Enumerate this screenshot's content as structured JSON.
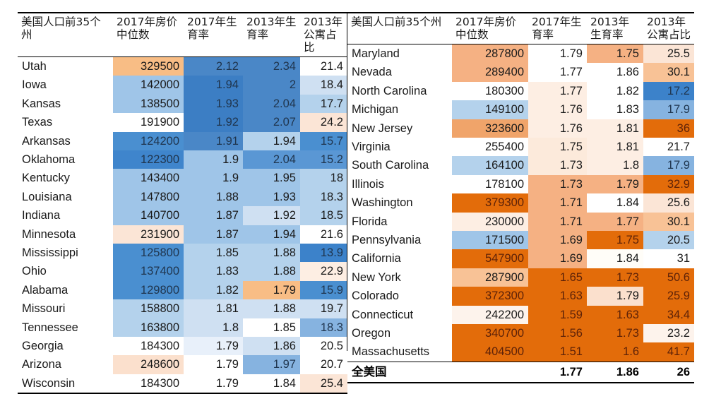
{
  "headers_left": [
    "美国人口前35个州",
    "2017年房价中位数",
    "2017年生育率",
    "2013年生育率",
    "2013年公寓占比"
  ],
  "headers_right": [
    "美国人口前35个州",
    "2017年房价中位数",
    "2017年生育率",
    "2013年生育率",
    "2013年公寓占比"
  ],
  "total_label": "全美国",
  "chart_data": {
    "type": "table",
    "title": "美国人口前35个州 房价中位数与生育率对照表",
    "columns": [
      "州",
      "2017年房价中位数",
      "2017年生育率",
      "2013年生育率",
      "2013年公寓占比"
    ],
    "colormap": {
      "low_blue": "#2e75b6",
      "mid_blue": "#9cc3e5",
      "neutral": "#ffffff",
      "mid_orange": "#f8cbad",
      "high_orange": "#e36c0a"
    },
    "left_rows": [
      {
        "state": "Utah",
        "price": "329500",
        "price_c": "#f8bd85",
        "fert2017": "2.12",
        "f17_c": "#4a87c7",
        "fert2013": "2.34",
        "f13_c": "#4a87c7",
        "apt": "21.4",
        "apt_c": "#ffffff"
      },
      {
        "state": "Iowa",
        "price": "142000",
        "price_c": "#9fc5e8",
        "fert2017": "1.94",
        "f17_c": "#3c7ec4",
        "fert2013": "2",
        "f13_c": "#4a87c7",
        "apt": "18.4",
        "apt_c": "#cfe0f2"
      },
      {
        "state": "Kansas",
        "price": "138500",
        "price_c": "#9fc5e8",
        "fert2017": "1.93",
        "f17_c": "#3c7ec4",
        "fert2013": "2.04",
        "f13_c": "#4a87c7",
        "apt": "17.7",
        "apt_c": "#b4d2ec"
      },
      {
        "state": "Texas",
        "price": "191900",
        "price_c": "#ffffff",
        "fert2017": "1.92",
        "f17_c": "#3c7ec4",
        "fert2013": "2.07",
        "f13_c": "#4a87c7",
        "apt": "24.2",
        "apt_c": "#fbe5d6"
      },
      {
        "state": "Arkansas",
        "price": "124200",
        "price_c": "#4a8fd0",
        "fert2017": "1.91",
        "f17_c": "#4a87c7",
        "fert2013": "1.94",
        "f13_c": "#b4d2ec",
        "apt": "15.7",
        "apt_c": "#4a8fd0"
      },
      {
        "state": "Oklahoma",
        "price": "122300",
        "price_c": "#3f85cc",
        "fert2017": "1.9",
        "f17_c": "#9fc5e8",
        "fert2013": "2.04",
        "f13_c": "#5a97d4",
        "apt": "15.2",
        "apt_c": "#5a97d4"
      },
      {
        "state": "Kentucky",
        "price": "143400",
        "price_c": "#9fc5e8",
        "fert2017": "1.9",
        "f17_c": "#9fc5e8",
        "fert2013": "1.95",
        "f13_c": "#9fc5e8",
        "apt": "18",
        "apt_c": "#b4d2ec"
      },
      {
        "state": "Louisiana",
        "price": "147800",
        "price_c": "#9fc5e8",
        "fert2017": "1.88",
        "f17_c": "#9fc5e8",
        "fert2013": "1.93",
        "f13_c": "#9fc5e8",
        "apt": "18.3",
        "apt_c": "#b4d2ec"
      },
      {
        "state": "Indiana",
        "price": "140700",
        "price_c": "#9fc5e8",
        "fert2017": "1.87",
        "f17_c": "#9fc5e8",
        "fert2013": "1.92",
        "f13_c": "#cfe0f2",
        "apt": "18.5",
        "apt_c": "#b4d2ec"
      },
      {
        "state": "Minnesota",
        "price": "231900",
        "price_c": "#fbe5d6",
        "fert2017": "1.87",
        "f17_c": "#9fc5e8",
        "fert2013": "1.94",
        "f13_c": "#9fc5e8",
        "apt": "21.6",
        "apt_c": "#ffffff"
      },
      {
        "state": "Mississippi",
        "price": "125800",
        "price_c": "#4a8fd0",
        "fert2017": "1.85",
        "f17_c": "#b4d2ec",
        "fert2013": "1.88",
        "f13_c": "#b4d2ec",
        "apt": "13.9",
        "apt_c": "#3c82ca"
      },
      {
        "state": "Ohio",
        "price": "137400",
        "price_c": "#4a8fd0",
        "fert2017": "1.83",
        "f17_c": "#b4d2ec",
        "fert2013": "1.88",
        "f13_c": "#b4d2ec",
        "apt": "22.9",
        "apt_c": "#fdeee3"
      },
      {
        "state": "Alabama",
        "price": "129800",
        "price_c": "#4a8fd0",
        "fert2017": "1.82",
        "f17_c": "#b4d2ec",
        "fert2013": "1.79",
        "f13_c": "#f8bd85",
        "apt": "15.9",
        "apt_c": "#4a8fd0"
      },
      {
        "state": "Missouri",
        "price": "158800",
        "price_c": "#b4d2ec",
        "fert2017": "1.81",
        "f17_c": "#cfe0f2",
        "fert2013": "1.88",
        "f13_c": "#cfe0f2",
        "apt": "19.7",
        "apt_c": "#cfe0f2"
      },
      {
        "state": "Tennessee",
        "price": "163800",
        "price_c": "#b4d2ec",
        "fert2017": "1.8",
        "f17_c": "#cfe0f2",
        "fert2013": "1.85",
        "f13_c": "#ffffff",
        "apt": "18.3",
        "apt_c": "#86b3e0"
      },
      {
        "state": "Georgia",
        "price": "184300",
        "price_c": "#ffffff",
        "fert2017": "1.79",
        "f17_c": "#e8f0fa",
        "fert2013": "1.86",
        "f13_c": "#cfe0f2",
        "apt": "20.5",
        "apt_c": "#ffffff"
      },
      {
        "state": "Arizona",
        "price": "248600",
        "price_c": "#fbe0cd",
        "fert2017": "1.79",
        "f17_c": "#ffffff",
        "fert2013": "1.97",
        "f13_c": "#86b3e0",
        "apt": "20.7",
        "apt_c": "#ffffff"
      },
      {
        "state": "Wisconsin",
        "price": "184300",
        "price_c": "#ffffff",
        "fert2017": "1.79",
        "f17_c": "#ffffff",
        "fert2013": "1.84",
        "f13_c": "#ffffff",
        "apt": "25.4",
        "apt_c": "#fbe5d6"
      }
    ],
    "right_rows": [
      {
        "state": "Maryland",
        "price": "287800",
        "price_c": "#f5b183",
        "fert2017": "1.79",
        "f17_c": "#ffffff",
        "fert2013": "1.75",
        "f13_c": "#f5b183",
        "apt": "25.5",
        "apt_c": "#fbe5d6"
      },
      {
        "state": "Nevada",
        "price": "289400",
        "price_c": "#f5b183",
        "fert2017": "1.77",
        "f17_c": "#ffffff",
        "fert2013": "1.86",
        "f13_c": "#ffffff",
        "apt": "30.1",
        "apt_c": "#f8c296"
      },
      {
        "state": "North Carolina",
        "price": "180300",
        "price_c": "#ffffff",
        "fert2017": "1.77",
        "f17_c": "#fdeee3",
        "fert2013": "1.82",
        "f13_c": "#ffffff",
        "apt": "17.2",
        "apt_c": "#3c82ca"
      },
      {
        "state": "Michigan",
        "price": "149100",
        "price_c": "#b4d2ec",
        "fert2017": "1.76",
        "f17_c": "#fdeee3",
        "fert2013": "1.83",
        "f13_c": "#ffffff",
        "apt": "17.9",
        "apt_c": "#86b3e0"
      },
      {
        "state": "New Jersey",
        "price": "323600",
        "price_c": "#f0a46a",
        "fert2017": "1.76",
        "f17_c": "#fdeee3",
        "fert2013": "1.81",
        "f13_c": "#fdeee3",
        "apt": "36",
        "apt_c": "#e36c0a"
      },
      {
        "state": "Virginia",
        "price": "255400",
        "price_c": "#ffffff",
        "fert2017": "1.75",
        "f17_c": "#fceadb",
        "fert2013": "1.81",
        "f13_c": "#fdeee3",
        "apt": "21.7",
        "apt_c": "#ffffff"
      },
      {
        "state": "South Carolina",
        "price": "164100",
        "price_c": "#b4d2ec",
        "fert2017": "1.73",
        "f17_c": "#fceadb",
        "fert2013": "1.8",
        "f13_c": "#fdeee3",
        "apt": "17.9",
        "apt_c": "#86b3e0"
      },
      {
        "state": "Illinois",
        "price": "178100",
        "price_c": "#ffffff",
        "fert2017": "1.73",
        "f17_c": "#f5b183",
        "fert2013": "1.79",
        "f13_c": "#f5b183",
        "apt": "32.9",
        "apt_c": "#e36c0a"
      },
      {
        "state": "Washington",
        "price": "379300",
        "price_c": "#e36c0a",
        "fert2017": "1.71",
        "f17_c": "#f5b183",
        "fert2013": "1.84",
        "f13_c": "#ffffff",
        "apt": "25.6",
        "apt_c": "#fbe5d6"
      },
      {
        "state": "Florida",
        "price": "230000",
        "price_c": "#fdeee3",
        "fert2017": "1.71",
        "f17_c": "#f5b183",
        "fert2013": "1.77",
        "f13_c": "#f5b183",
        "apt": "30.1",
        "apt_c": "#f8c296"
      },
      {
        "state": "Pennsylvania",
        "price": "171500",
        "price_c": "#9fc5e8",
        "fert2017": "1.69",
        "f17_c": "#f5b183",
        "fert2013": "1.75",
        "f13_c": "#e36c0a",
        "apt": "20.5",
        "apt_c": "#b4d2ec"
      },
      {
        "state": "California",
        "price": "547900",
        "price_c": "#e36c0a",
        "fert2017": "1.69",
        "f17_c": "#f5b183",
        "fert2013": "1.84",
        "f13_c": "#fffdf8",
        "apt": "31",
        "apt_c": "#ffffff"
      },
      {
        "state": "New York",
        "price": "287900",
        "price_c": "#f8c296",
        "fert2017": "1.65",
        "f17_c": "#e36c0a",
        "fert2013": "1.73",
        "f13_c": "#e36c0a",
        "apt": "50.6",
        "apt_c": "#e36c0a"
      },
      {
        "state": "Colorado",
        "price": "372300",
        "price_c": "#e36c0a",
        "fert2017": "1.63",
        "f17_c": "#e36c0a",
        "fert2013": "1.79",
        "f13_c": "#fbe0cd",
        "apt": "25.9",
        "apt_c": "#e36c0a"
      },
      {
        "state": "Connecticut",
        "price": "242200",
        "price_c": "#fdf3ec",
        "fert2017": "1.59",
        "f17_c": "#e36c0a",
        "fert2013": "1.63",
        "f13_c": "#e36c0a",
        "apt": "34.4",
        "apt_c": "#e36c0a"
      },
      {
        "state": "Oregon",
        "price": "340700",
        "price_c": "#e36c0a",
        "fert2017": "1.56",
        "f17_c": "#e36c0a",
        "fert2013": "1.73",
        "f13_c": "#e36c0a",
        "apt": "23.2",
        "apt_c": "#fdf3ec"
      },
      {
        "state": "Massachusetts",
        "price": "404500",
        "price_c": "#e36c0a",
        "fert2017": "1.51",
        "f17_c": "#e36c0a",
        "fert2013": "1.6",
        "f13_c": "#e36c0a",
        "apt": "41.7",
        "apt_c": "#e36c0a"
      }
    ],
    "total_row": {
      "state": "全美国",
      "price": "",
      "fert2017": "1.77",
      "fert2013": "1.86",
      "apt": "26"
    }
  }
}
